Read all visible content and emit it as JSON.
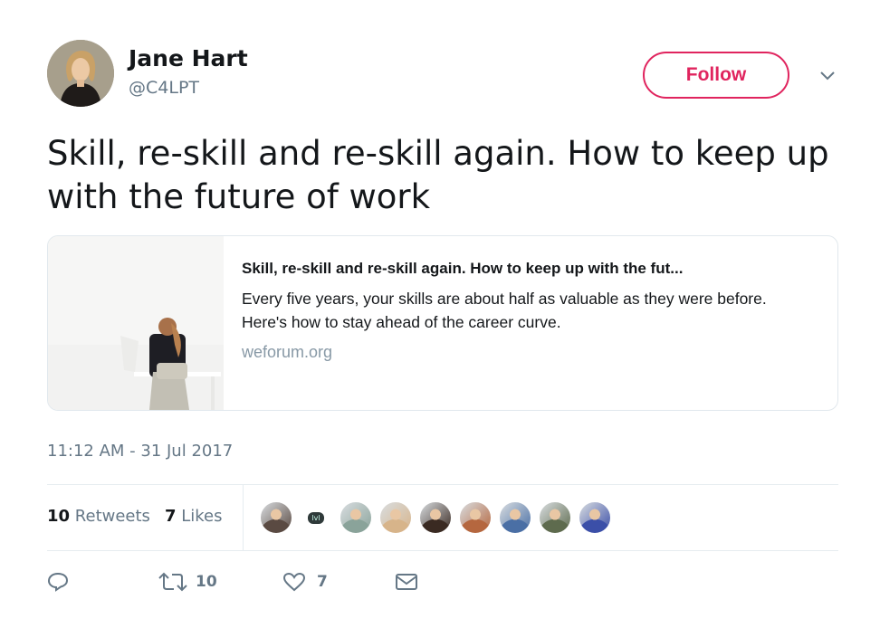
{
  "author": {
    "name": "Jane Hart",
    "handle": "@C4LPT"
  },
  "follow_button": {
    "label": "Follow"
  },
  "tweet": {
    "text": "Skill, re-skill and re-skill again. How to keep up with the future of work"
  },
  "card": {
    "title": "Skill, re-skill and re-skill again. How to keep up with the fut...",
    "description": "Every five years, your skills are about half as valuable as they were before. Here's how to stay ahead of the career curve.",
    "domain": "weforum.org"
  },
  "timestamp": "11:12 AM - 31 Jul 2017",
  "stats": {
    "retweets_count": "10",
    "retweets_label": "Retweets",
    "likes_count": "7",
    "likes_label": "Likes"
  },
  "actions": {
    "reply_count": "",
    "retweet_count": "10",
    "like_count": "7"
  },
  "liker_avatars": [
    {
      "color": "#5a4a42"
    },
    {
      "color": "#2f3a3a",
      "label": "lvl"
    },
    {
      "color": "#8aa39a"
    },
    {
      "color": "#d7b48a"
    },
    {
      "color": "#3a2a22"
    },
    {
      "color": "#b5673f"
    },
    {
      "color": "#4a6fa5"
    },
    {
      "color": "#5e6b4e"
    },
    {
      "color": "#3b4fa8"
    }
  ],
  "colors": {
    "accent": "#e0245e",
    "secondary_text": "#657786",
    "border": "#e1e8ed"
  }
}
